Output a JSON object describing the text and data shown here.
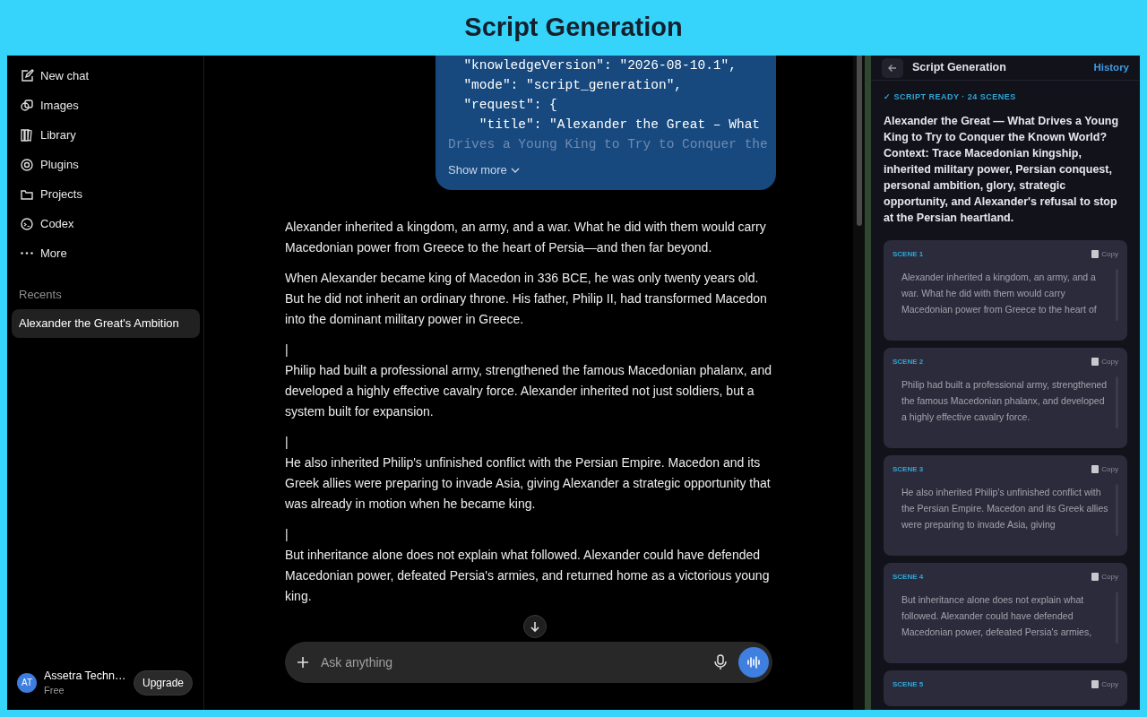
{
  "banner": {
    "title": "Script Generation"
  },
  "sidebar": {
    "nav": [
      {
        "label": "New chat"
      },
      {
        "label": "Images"
      },
      {
        "label": "Library"
      },
      {
        "label": "Plugins"
      },
      {
        "label": "Projects"
      },
      {
        "label": "Codex"
      },
      {
        "label": "More"
      }
    ],
    "recents_label": "Recents",
    "recents": [
      {
        "label": "Alexander the Great's Ambition",
        "selected": true
      }
    ],
    "account": {
      "initials": "AT",
      "name": "Assetra Techn…",
      "plan": "Free"
    },
    "upgrade_button": "Upgrade"
  },
  "chat": {
    "code_lines": [
      {
        "text": "  \"knowledgeVersion\": \"2026-08-10.1\",",
        "faded": false
      },
      {
        "text": "  \"mode\": \"script_generation\",",
        "faded": false
      },
      {
        "text": "  \"request\": {",
        "faded": false
      },
      {
        "text": "    \"title\": \"Alexander the Great – What",
        "faded": false
      },
      {
        "text": "Drives a Young King to Try to Conquer the",
        "faded": true
      }
    ],
    "show_more": "Show more",
    "paragraphs": [
      {
        "kind": "text",
        "text": "Alexander inherited a kingdom, an army, and a war. What he did with them would carry Macedonian power from Greece to the heart of Persia—and then far beyond."
      },
      {
        "kind": "text",
        "text": "When Alexander became king of Macedon in 336 BCE, he was only twenty years old. But he did not inherit an ordinary throne. His father, Philip II, had transformed Macedon into the dominant military power in Greece."
      },
      {
        "kind": "cursor",
        "text": "|"
      },
      {
        "kind": "text",
        "text": "Philip had built a professional army, strengthened the famous Macedonian phalanx, and developed a highly effective cavalry force. Alexander inherited not just soldiers, but a system built for expansion."
      },
      {
        "kind": "cursor",
        "text": "|"
      },
      {
        "kind": "text",
        "text": "He also inherited Philip's unfinished conflict with the Persian Empire. Macedon and its Greek allies were preparing to invade Asia, giving Alexander a strategic opportunity that was already in motion when he became king."
      },
      {
        "kind": "cursor",
        "text": "|"
      },
      {
        "kind": "text",
        "text": "But inheritance alone does not explain what followed. Alexander could have defended Macedonian power, defeated Persia's armies, and returned home as a victorious young king."
      }
    ],
    "composer": {
      "placeholder": "Ask anything"
    }
  },
  "panel": {
    "title": "Script Generation",
    "history_link": "History",
    "status": "✓ SCRIPT READY · 24 SCENES",
    "heading": "Alexander the Great — What Drives a Young King to Try to Conquer the Known World? Context: Trace Macedonian kingship, inherited military power, Persian conquest, personal ambition, glory, strategic opportunity, and Alexander's refusal to stop at the Persian heartland.",
    "scenes": [
      {
        "label": "SCENE 1",
        "copy": "Copy",
        "text": "Alexander inherited a kingdom, an army, and a war. What he did with them would carry Macedonian power from Greece to the heart of"
      },
      {
        "label": "SCENE 2",
        "copy": "Copy",
        "text": "Philip had built a professional army, strengthened the famous Macedonian phalanx, and developed a highly effective cavalry force."
      },
      {
        "label": "SCENE 3",
        "copy": "Copy",
        "text": "He also inherited Philip's unfinished conflict with the Persian Empire. Macedon and its Greek allies were preparing to invade Asia, giving"
      },
      {
        "label": "SCENE 4",
        "copy": "Copy",
        "text": "But inheritance alone does not explain what followed. Alexander could have defended Macedonian power, defeated Persia's armies,"
      },
      {
        "label": "SCENE 5",
        "copy": "Copy"
      }
    ]
  }
}
